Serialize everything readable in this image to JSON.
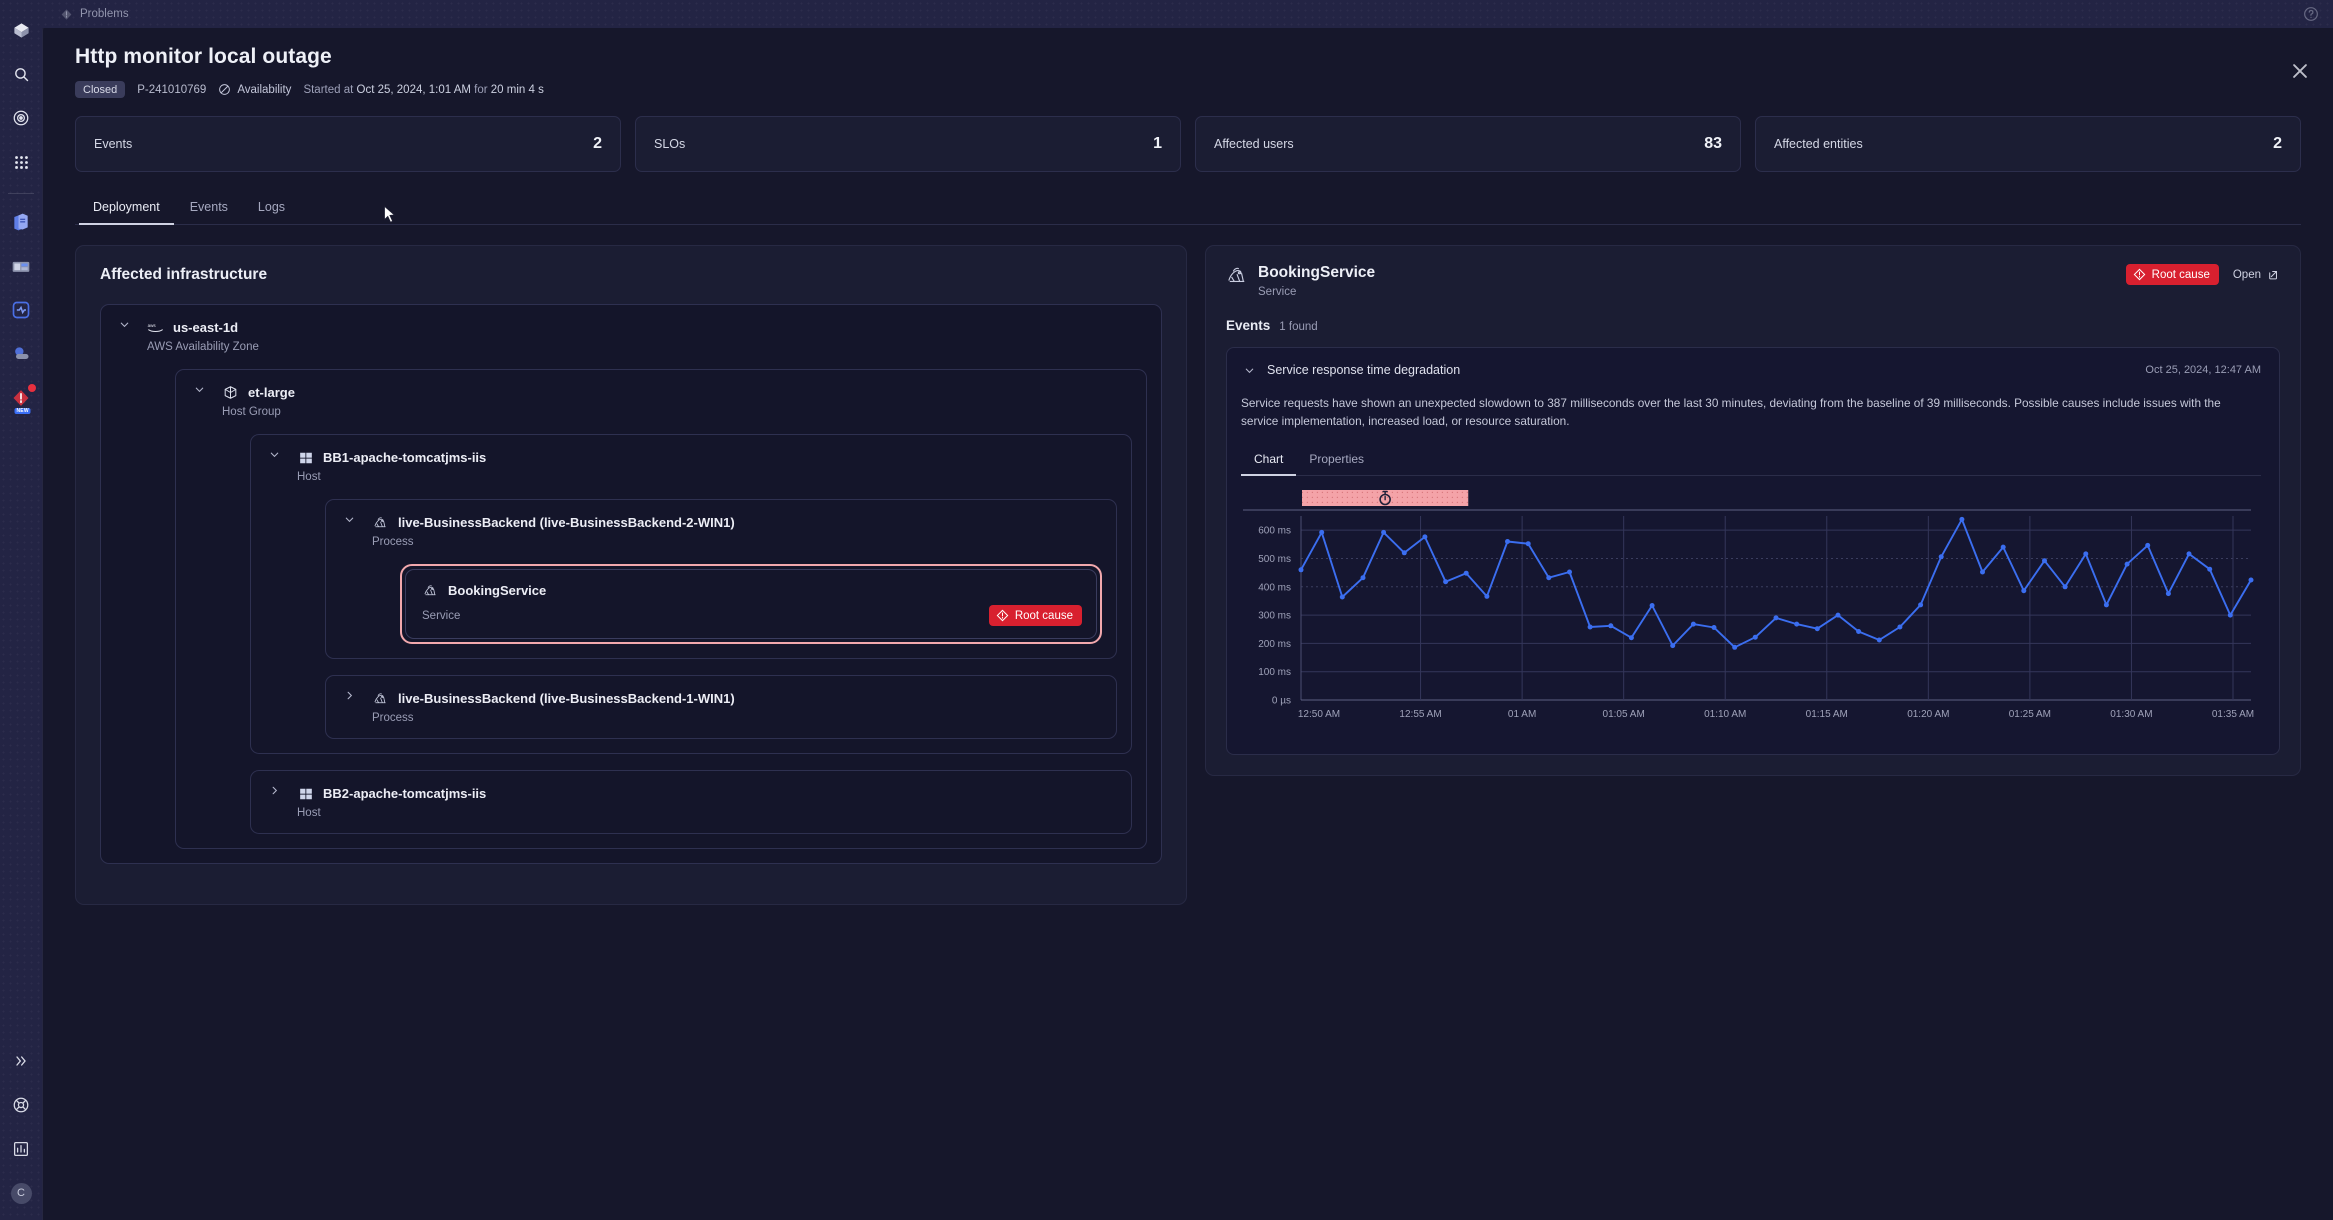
{
  "app": {
    "tab_label": "Problems",
    "tab_icon": "problem-icon",
    "help_icon": "help-circle-icon",
    "close_icon": "close-icon"
  },
  "rail": {
    "top_items": [
      {
        "name": "dynatrace-logo-icon",
        "label": "Dynatrace"
      },
      {
        "name": "search-icon",
        "label": "Search"
      },
      {
        "name": "davis-ai-icon",
        "label": "Davis AI"
      },
      {
        "name": "apps-grid-icon",
        "label": "Apps"
      }
    ],
    "app_items": [
      {
        "name": "notebooks-icon",
        "label": "Notebooks"
      },
      {
        "name": "dashboards-icon",
        "label": "Dashboards"
      },
      {
        "name": "infrastructure-observability-icon",
        "label": "Infrastructure & Operations"
      },
      {
        "name": "kubernetes-icon",
        "label": "Kubernetes"
      },
      {
        "name": "problems-app-icon",
        "label": "Problems",
        "badge": true,
        "new_tag": "NEW"
      }
    ],
    "bottom_items": [
      {
        "name": "expand-chevrons-icon",
        "label": "Expand"
      },
      {
        "name": "lifebuoy-help-icon",
        "label": "Help"
      },
      {
        "name": "chart-report-icon",
        "label": "Reports"
      }
    ],
    "avatar_initial": "C"
  },
  "header": {
    "title": "Http monitor local outage",
    "status": "Closed",
    "problem_id": "P-241010769",
    "category_icon": "availability-icon",
    "category": "Availability",
    "started_prefix": "Started at",
    "started_at": "Oct 25, 2024, 1:01 AM",
    "duration_prefix": "for",
    "duration": "20 min 4 s"
  },
  "kpis": [
    {
      "label": "Events",
      "value": "2"
    },
    {
      "label": "SLOs",
      "value": "1"
    },
    {
      "label": "Affected users",
      "value": "83"
    },
    {
      "label": "Affected entities",
      "value": "2"
    }
  ],
  "tabs": [
    {
      "label": "Deployment",
      "active": true
    },
    {
      "label": "Events",
      "active": false
    },
    {
      "label": "Logs",
      "active": false
    }
  ],
  "left_panel": {
    "title": "Affected infrastructure",
    "tree": {
      "name": "us-east-1d",
      "type": "AWS Availability Zone",
      "icon": "aws-icon",
      "expanded": true,
      "child": {
        "name": "et-large",
        "type": "Host Group",
        "icon": "cube-icon",
        "expanded": true,
        "hosts": [
          {
            "name": "BB1-apache-tomcatjms-iis",
            "type": "Host",
            "icon": "windows-icon",
            "expanded": true,
            "processes": [
              {
                "name": "live-BusinessBackend (live-BusinessBackend-2-WIN1)",
                "type": "Process",
                "icon": "process-icon",
                "expanded": true,
                "service": {
                  "name": "BookingService",
                  "type": "Service",
                  "icon": "service-icon",
                  "badge": "Root cause",
                  "badge_icon": "root-cause-icon",
                  "highlighted": true
                }
              },
              {
                "name": "live-BusinessBackend (live-BusinessBackend-1-WIN1)",
                "type": "Process",
                "icon": "process-icon",
                "expanded": false
              }
            ]
          },
          {
            "name": "BB2-apache-tomcatjms-iis",
            "type": "Host",
            "icon": "windows-icon",
            "expanded": false
          }
        ]
      }
    }
  },
  "right_panel": {
    "entity_icon": "service-icon",
    "entity_name": "BookingService",
    "entity_type": "Service",
    "root_cause_badge": "Root cause",
    "root_cause_icon": "root-cause-icon",
    "open_label": "Open",
    "open_icon": "external-link-icon",
    "events_label": "Events",
    "events_count": "1 found",
    "event": {
      "chevron_icon": "chevron-down-icon",
      "title": "Service response time degradation",
      "timestamp": "Oct 25, 2024, 12:47 AM",
      "description": "Service requests have shown an unexpected slowdown to 387 milliseconds over the last 30 minutes, deviating from the baseline of 39 milliseconds. Possible causes include issues with the service implementation, increased load, or resource saturation.",
      "tabs": [
        {
          "label": "Chart",
          "active": true
        },
        {
          "label": "Properties",
          "active": false
        }
      ]
    }
  },
  "chart_data": {
    "type": "line",
    "title": "",
    "xlabel": "",
    "ylabel": "",
    "ylim": [
      0,
      650
    ],
    "ytick_labels": [
      "0 µs",
      "100 ms",
      "200 ms",
      "300 ms",
      "400 ms",
      "500 ms",
      "600 ms"
    ],
    "ytick_values": [
      0,
      100,
      200,
      300,
      400,
      500,
      600
    ],
    "xtick_labels": [
      "12:50 AM",
      "12:55 AM",
      "01 AM",
      "01:05 AM",
      "01:10 AM",
      "01:15 AM",
      "01:20 AM",
      "01:25 AM",
      "01:30 AM",
      "01:35 AM"
    ],
    "grid": true,
    "legend": "none",
    "series_color": "#3b6ef0",
    "annotation_band": {
      "label": "event-duration-band",
      "icon": "stopwatch-icon",
      "color": "#f4a3a8",
      "start_label": "12:50 AM",
      "end_label": "12:58 AM"
    },
    "series": [
      {
        "name": "Response time",
        "unit": "ms",
        "x": [
          "12:49",
          "12:50",
          "12:51",
          "12:52",
          "12:53",
          "12:54",
          "12:55",
          "12:56",
          "12:57",
          "12:58",
          "12:59",
          "01:00",
          "01:01",
          "01:02",
          "01:03",
          "01:04",
          "01:05",
          "01:06",
          "01:07",
          "01:08",
          "01:09",
          "01:10",
          "01:11",
          "01:12",
          "01:13",
          "01:14",
          "01:15",
          "01:16",
          "01:17",
          "01:18",
          "01:19",
          "01:20",
          "01:21",
          "01:22",
          "01:23",
          "01:24",
          "01:25",
          "01:26",
          "01:27",
          "01:28",
          "01:29",
          "01:30",
          "01:31",
          "01:32",
          "01:33",
          "01:34",
          "01:35"
        ],
        "values": [
          460,
          592,
          364,
          432,
          592,
          520,
          576,
          418,
          448,
          366,
          560,
          552,
          432,
          452,
          258,
          262,
          220,
          334,
          192,
          268,
          256,
          186,
          222,
          290,
          268,
          252,
          300,
          242,
          212,
          258,
          336,
          506,
          638,
          452,
          540,
          386,
          492,
          400,
          516,
          336,
          480,
          546,
          376,
          516,
          462,
          300,
          424
        ]
      }
    ]
  }
}
